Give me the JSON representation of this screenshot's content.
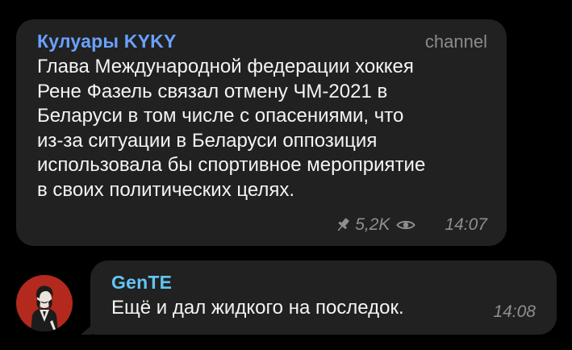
{
  "channel_post": {
    "sender": "Кулуары KYKY",
    "tag": "channel",
    "text": "Глава Международной федерации хоккея\nРене Фазель связал отмену ЧМ-2021 в\nБеларуси в том числе с опасениями, что\nиз-за ситуации в Беларуси оппозиция\nиспользовала бы спортивное мероприятие\nв своих политических целях.",
    "views": "5,2K",
    "time": "14:07",
    "pin_icon": "pin-icon",
    "eye_icon": "eye-icon"
  },
  "reply": {
    "sender": "GenTE",
    "text": "Ещё и дал жидкого на последок.",
    "time": "14:08",
    "avatar": "user-avatar"
  },
  "colors": {
    "background": "#000000",
    "bubble": "#212121",
    "channel_name": "#6aa1ff",
    "user_name": "#61c5f4",
    "meta": "#8e8e93",
    "avatar_bg": "#b3291d"
  }
}
